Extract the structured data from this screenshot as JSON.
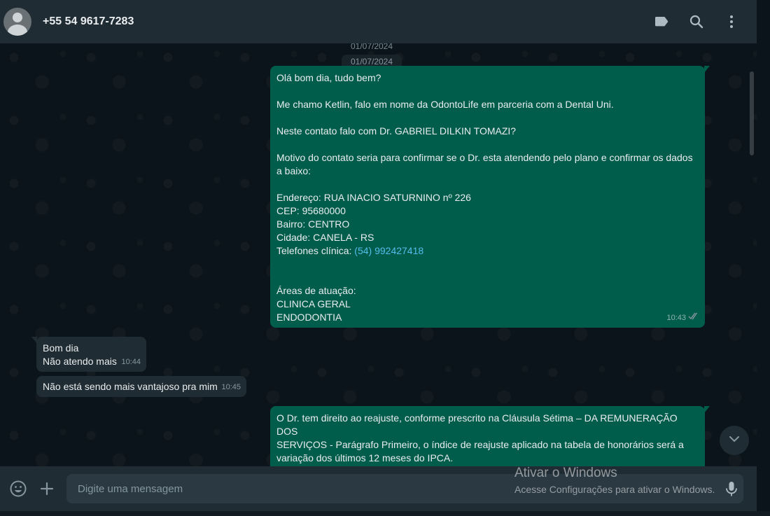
{
  "header": {
    "contact_name": "+55 54 9617-7283",
    "icons": [
      "label-icon",
      "search-icon",
      "menu-icon"
    ]
  },
  "chat": {
    "date_ghost": "01/07/2024",
    "date": "01/07/2024",
    "messages": [
      {
        "direction": "out",
        "lines": [
          "Olá bom dia, tudo bem?",
          "",
          "Me chamo Ketlin, falo em nome da OdontoLife em parceria com a Dental Uni.",
          "",
          "Neste contato falo com Dr. GABRIEL DILKIN TOMAZI?",
          "",
          "Motivo do contato seria para confirmar se o Dr. esta atendendo pelo plano e confirmar os dados",
          "a baixo:",
          "",
          "Endereço: RUA INACIO SATURNINO nº 226",
          "CEP: 95680000",
          "Bairro: CENTRO",
          "Cidade: CANELA - RS"
        ],
        "phone_label": "Telefones clínica: ",
        "phone_link": "(54) 992427418",
        "lines_after": [
          "",
          "",
          "Áreas de atuação:",
          "CLINICA GERAL",
          "ENDODONTIA"
        ],
        "time": "10:43",
        "status": "read-checks-icon"
      },
      {
        "direction": "in",
        "lines": [
          "Bom dia",
          "Não atendo mais"
        ],
        "time": "10:44"
      },
      {
        "direction": "in",
        "lines": [
          "Não está sendo mais vantajoso pra mim"
        ],
        "time": "10:45"
      },
      {
        "direction": "out",
        "lines": [
          "O Dr. tem direito ao reajuste, conforme prescrito na Cláusula Sétima – DA REMUNERAÇÃO DOS",
          "SERVIÇOS - Parágrafo Primeiro, o índice de reajuste aplicado na tabela de honorários será a",
          "variação dos últimos 12 meses do IPCA."
        ]
      }
    ]
  },
  "footer": {
    "placeholder": "Digite uma mensagem",
    "icons": [
      "emoji-icon",
      "plus-icon",
      "microphone-icon"
    ]
  },
  "watermark": {
    "title": "Ativar o Windows",
    "subtitle": "Acesse Configurações para ativar o Windows."
  },
  "colors": {
    "header_bg": "#202c33",
    "chat_bg": "#0b141a",
    "outgoing_bubble": "#005c4b",
    "incoming_bubble": "#202c33",
    "link": "#53bdeb"
  }
}
